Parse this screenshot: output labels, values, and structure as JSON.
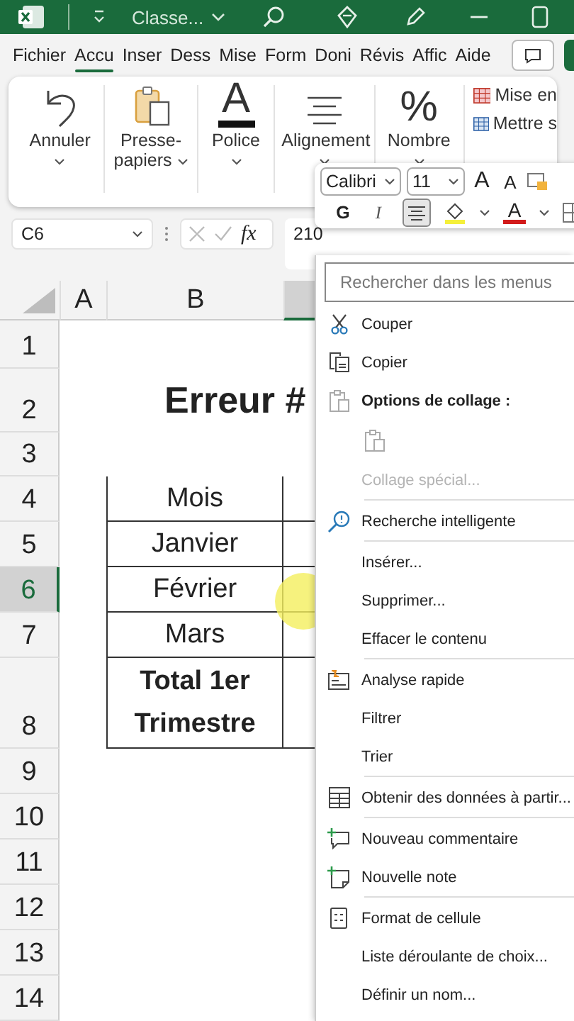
{
  "title_bar": {
    "file_name": "Classe..."
  },
  "ribbon_tabs": [
    {
      "label": "Fichier",
      "selected": false
    },
    {
      "label": "Accu",
      "selected": true
    },
    {
      "label": "Inser",
      "selected": false
    },
    {
      "label": "Dess",
      "selected": false
    },
    {
      "label": "Mise",
      "selected": false
    },
    {
      "label": "Form",
      "selected": false
    },
    {
      "label": "Doni",
      "selected": false
    },
    {
      "label": "Révis",
      "selected": false
    },
    {
      "label": "Affic",
      "selected": false
    },
    {
      "label": "Aide",
      "selected": false
    }
  ],
  "ribbon_groups": [
    {
      "label": "Annuler"
    },
    {
      "label": "Presse-papiers"
    },
    {
      "label": "Police",
      "glyph": "A"
    },
    {
      "label": "Alignement"
    },
    {
      "label": "Nombre",
      "glyph": "%"
    }
  ],
  "styles_group": {
    "items": [
      "Mise en",
      "Mettre s"
    ]
  },
  "formula_bar": {
    "name_box": "C6",
    "function_label": "fx",
    "formula": "210"
  },
  "mini_toolbar": {
    "font": "Calibri",
    "size": "11",
    "grow_font": "A",
    "shrink_font": "A",
    "bold": "G",
    "italic": "I",
    "center_align_on": true,
    "font_color": "A"
  },
  "sheet": {
    "columns": [
      {
        "label": "A",
        "selected": false
      },
      {
        "label": "B",
        "selected": false
      },
      {
        "selected": true
      }
    ],
    "rows": [
      {
        "label": "1",
        "selected": false
      },
      {
        "label": "2",
        "selected": false
      },
      {
        "label": "3",
        "selected": false
      },
      {
        "label": "4",
        "selected": false
      },
      {
        "label": "5",
        "selected": false
      },
      {
        "label": "6",
        "selected": true
      },
      {
        "label": "7",
        "selected": false
      },
      {
        "label": "8",
        "selected": false
      },
      {
        "label": "9",
        "selected": false
      },
      {
        "label": "10",
        "selected": false
      },
      {
        "label": "11",
        "selected": false
      },
      {
        "label": "12",
        "selected": false
      },
      {
        "label": "13",
        "selected": false
      },
      {
        "label": "14",
        "selected": false
      }
    ],
    "title": "Erreur #",
    "table": [
      {
        "text": "Mois",
        "bold": false
      },
      {
        "text": "Janvier",
        "bold": false
      },
      {
        "text": "Février",
        "bold": false
      },
      {
        "text": "Mars",
        "bold": false
      },
      {
        "text": "Total 1er Trimestre",
        "bold": true
      }
    ]
  },
  "context_menu": {
    "search": {
      "placeholder": "Rechercher dans les menus"
    },
    "items": [
      {
        "kind": "item",
        "label": "Couper",
        "disabled": false
      },
      {
        "kind": "item",
        "label": "Copier",
        "disabled": false
      },
      {
        "kind": "header",
        "label": "Options de collage :"
      },
      {
        "kind": "paste"
      },
      {
        "kind": "item",
        "label": "Collage spécial...",
        "disabled": true
      },
      {
        "kind": "separator"
      },
      {
        "kind": "item",
        "label": "Recherche intelligente",
        "disabled": false
      },
      {
        "kind": "separator"
      },
      {
        "kind": "item",
        "label": "Insérer...",
        "disabled": false
      },
      {
        "kind": "item",
        "label": "Supprimer...",
        "disabled": false
      },
      {
        "kind": "item",
        "label": "Effacer le contenu",
        "disabled": false
      },
      {
        "kind": "separator"
      },
      {
        "kind": "item",
        "label": "Analyse rapide",
        "disabled": false
      },
      {
        "kind": "item",
        "label": "Filtrer",
        "disabled": false
      },
      {
        "kind": "item",
        "label": "Trier",
        "disabled": false
      },
      {
        "kind": "separator"
      },
      {
        "kind": "item",
        "label": "Obtenir des données à partir...",
        "disabled": false
      },
      {
        "kind": "separator"
      },
      {
        "kind": "item",
        "label": "Nouveau commentaire",
        "disabled": false
      },
      {
        "kind": "item",
        "label": "Nouvelle note",
        "disabled": false
      },
      {
        "kind": "separator"
      },
      {
        "kind": "item",
        "label": "Format de cellule",
        "disabled": false
      },
      {
        "kind": "item",
        "label": "Liste déroulante de choix...",
        "disabled": false
      },
      {
        "kind": "item",
        "label": "Définir un nom...",
        "disabled": false
      }
    ]
  }
}
